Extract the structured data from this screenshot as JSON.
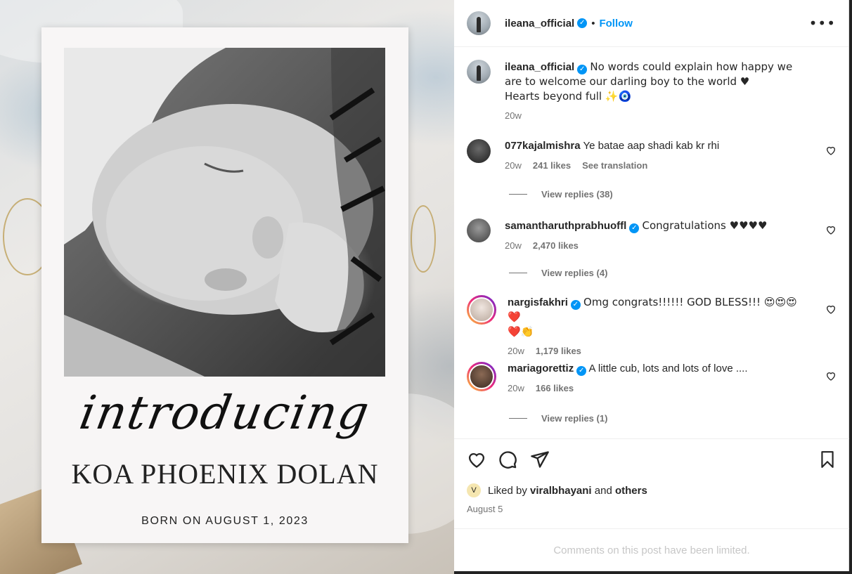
{
  "post": {
    "author": "ileana_official",
    "follow_label": "Follow",
    "more_icon": "more-options-icon",
    "caption_author": "ileana_official",
    "caption_line1": "No words could explain how happy we are to welcome our darling boy to the world ♥",
    "caption_line2": "Hearts beyond full ✨🧿",
    "caption_time": "20w"
  },
  "media": {
    "intro_text": "introducing",
    "baby_name": "KOA PHOENIX DOLAN",
    "born_text": "BORN ON AUGUST 1, 2023"
  },
  "comments": [
    {
      "user": "077kajalmishra",
      "verified": false,
      "text": "Ye batae aap shadi kab kr rhi",
      "time": "20w",
      "likes": "241 likes",
      "extra": "See translation",
      "replies": "View replies (38)"
    },
    {
      "user": "samantharuthprabhuoffl",
      "verified": true,
      "text": "Congratulations ♥♥♥♥",
      "time": "20w",
      "likes": "2,470 likes",
      "replies": "View replies (4)"
    },
    {
      "user": "nargisfakhri",
      "verified": true,
      "text": "Omg congrats!!!!!! GOD BLESS!!! 😍😍😍❤️",
      "text_line2": "❤️👏",
      "time": "20w",
      "likes": "1,179 likes"
    },
    {
      "user": "mariagorettiz",
      "verified": true,
      "text": "A little cub, lots and lots of love ....",
      "time": "20w",
      "likes": "166 likes",
      "replies": "View replies (1)"
    }
  ],
  "likes": {
    "liked_by_prefix": "Liked by",
    "liked_user": "viralbhayani",
    "and": "and",
    "others": "others"
  },
  "date": "August 5",
  "limited_notice": "Comments on this post have been limited.",
  "colors": {
    "accent": "#0095f6",
    "text": "#262626",
    "muted": "#737373"
  }
}
